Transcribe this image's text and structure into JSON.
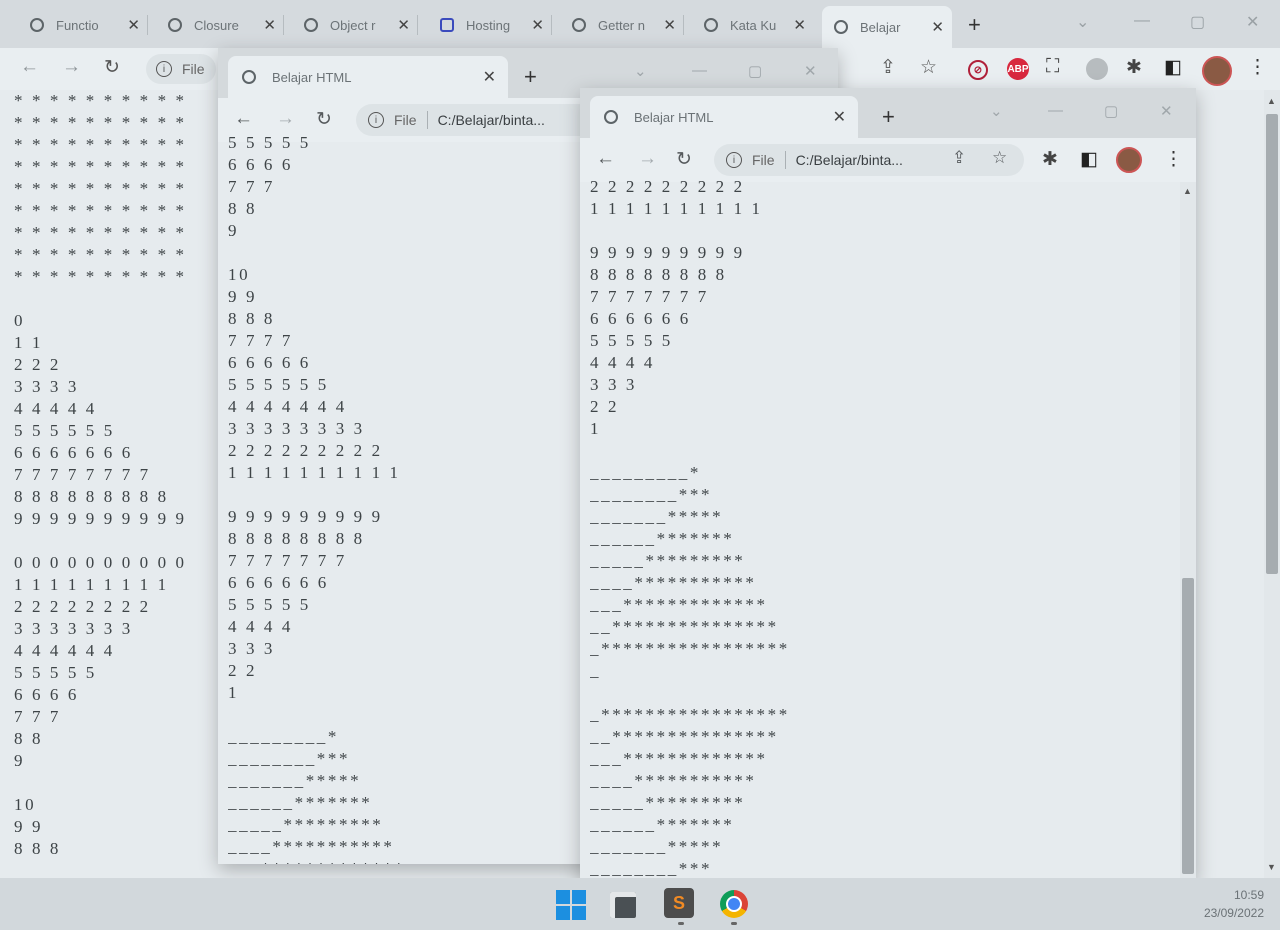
{
  "main_window": {
    "tabs": [
      {
        "title": "Functio"
      },
      {
        "title": "Closure"
      },
      {
        "title": "Object r"
      },
      {
        "title": "Hosting"
      },
      {
        "title": "Getter n"
      },
      {
        "title": "Kata Ku"
      },
      {
        "title": "Belajar"
      }
    ],
    "address_label": "File",
    "content": [
      "* * * * * * * * * *",
      "* * * * * * * * * *",
      "* * * * * * * * * *",
      "* * * * * * * * * *",
      "* * * * * * * * * *",
      "* * * * * * * * * *",
      "* * * * * * * * * *",
      "* * * * * * * * * *",
      "* * * * * * * * * *",
      "",
      "0",
      "1 1",
      "2 2 2",
      "3 3 3 3",
      "4 4 4 4 4",
      "5 5 5 5 5 5",
      "6 6 6 6 6 6 6",
      "7 7 7 7 7 7 7 7",
      "8 8 8 8 8 8 8 8 8",
      "9 9 9 9 9 9 9 9 9 9",
      "",
      "0 0 0 0 0 0 0 0 0 0",
      "1 1 1 1 1 1 1 1 1",
      "2 2 2 2 2 2 2 2",
      "3 3 3 3 3 3 3",
      "4 4 4 4 4 4",
      "5 5 5 5 5",
      "6 6 6 6",
      "7 7 7",
      "8 8",
      "9",
      "",
      "10",
      "9 9",
      "8 8 8"
    ]
  },
  "popup1": {
    "tab_title": "Belajar HTML",
    "address_label": "File",
    "address": "C:/Belajar/binta...",
    "content": [
      "5 5 5 5 5",
      "6 6 6 6",
      "7 7 7",
      "8 8",
      "9",
      "",
      "10",
      "9 9",
      "8 8 8",
      "7 7 7 7",
      "6 6 6 6 6",
      "5 5 5 5 5 5",
      "4 4 4 4 4 4 4",
      "3 3 3 3 3 3 3 3",
      "2 2 2 2 2 2 2 2 2",
      "1 1 1 1 1 1 1 1 1 1",
      "",
      "9 9 9 9 9 9 9 9 9",
      "8 8 8 8 8 8 8 8",
      "7 7 7 7 7 7 7",
      "6 6 6 6 6 6",
      "5 5 5 5 5",
      "4 4 4 4",
      "3 3 3",
      "2 2",
      "1",
      "",
      "_________*",
      "________***",
      "_______*****",
      "______*******",
      "_____*********",
      "____***********",
      "___*************"
    ]
  },
  "popup2": {
    "tab_title": "Belajar HTML",
    "address_label": "File",
    "address": "C:/Belajar/binta...",
    "content": [
      "2 2 2 2 2 2 2 2 2",
      "1 1 1 1 1 1 1 1 1 1",
      "",
      "9 9 9 9 9 9 9 9 9",
      "8 8 8 8 8 8 8 8",
      "7 7 7 7 7 7 7",
      "6 6 6 6 6 6",
      "5 5 5 5 5",
      "4 4 4 4",
      "3 3 3",
      "2 2",
      "1",
      "",
      "_________*",
      "________***",
      "_______*****",
      "______*******",
      "_____*********",
      "____***********",
      "___*************",
      "__***************",
      "_*****************",
      "_",
      "",
      "_*****************",
      "__***************",
      "___*************",
      "____***********",
      "_____*********",
      "______*******",
      "_______*****",
      "________***",
      "_________*"
    ]
  },
  "taskbar": {
    "time": "10:59",
    "date": "23/09/2022"
  }
}
